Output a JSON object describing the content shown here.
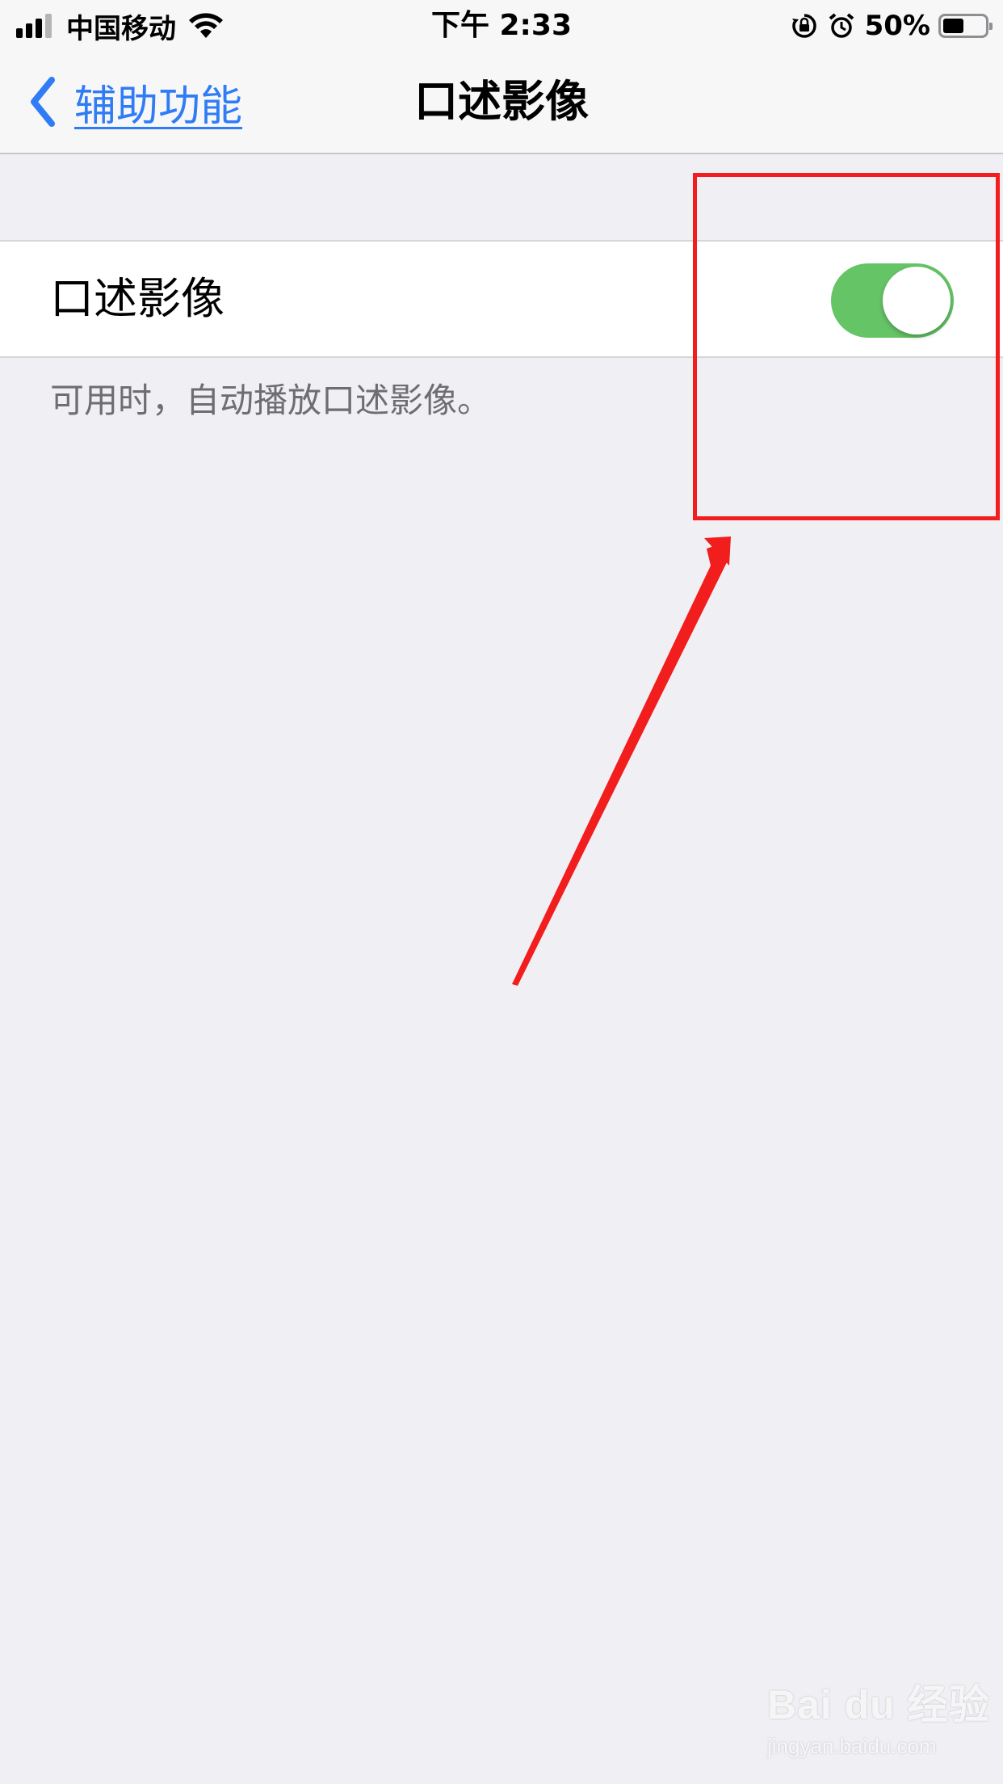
{
  "status_bar": {
    "carrier": "中国移动",
    "time": "下午 2:33",
    "battery_percent": "50%",
    "battery_level": 0.5,
    "icons": [
      "signal-icon",
      "wifi-icon",
      "orientation-lock-icon",
      "alarm-icon",
      "battery-icon"
    ]
  },
  "nav": {
    "back_label": "辅助功能",
    "title": "口述影像"
  },
  "setting": {
    "label": "口述影像",
    "toggle_on": true,
    "footer": "可用时，自动播放口述影像。"
  },
  "colors": {
    "accent": "#2f7cf6",
    "toggle_on": "#65c466",
    "annotation": "#f21d1d",
    "background": "#f0eff4"
  },
  "watermark": {
    "main": "Bai du 经验",
    "sub": "jingyan.baidu.com"
  }
}
